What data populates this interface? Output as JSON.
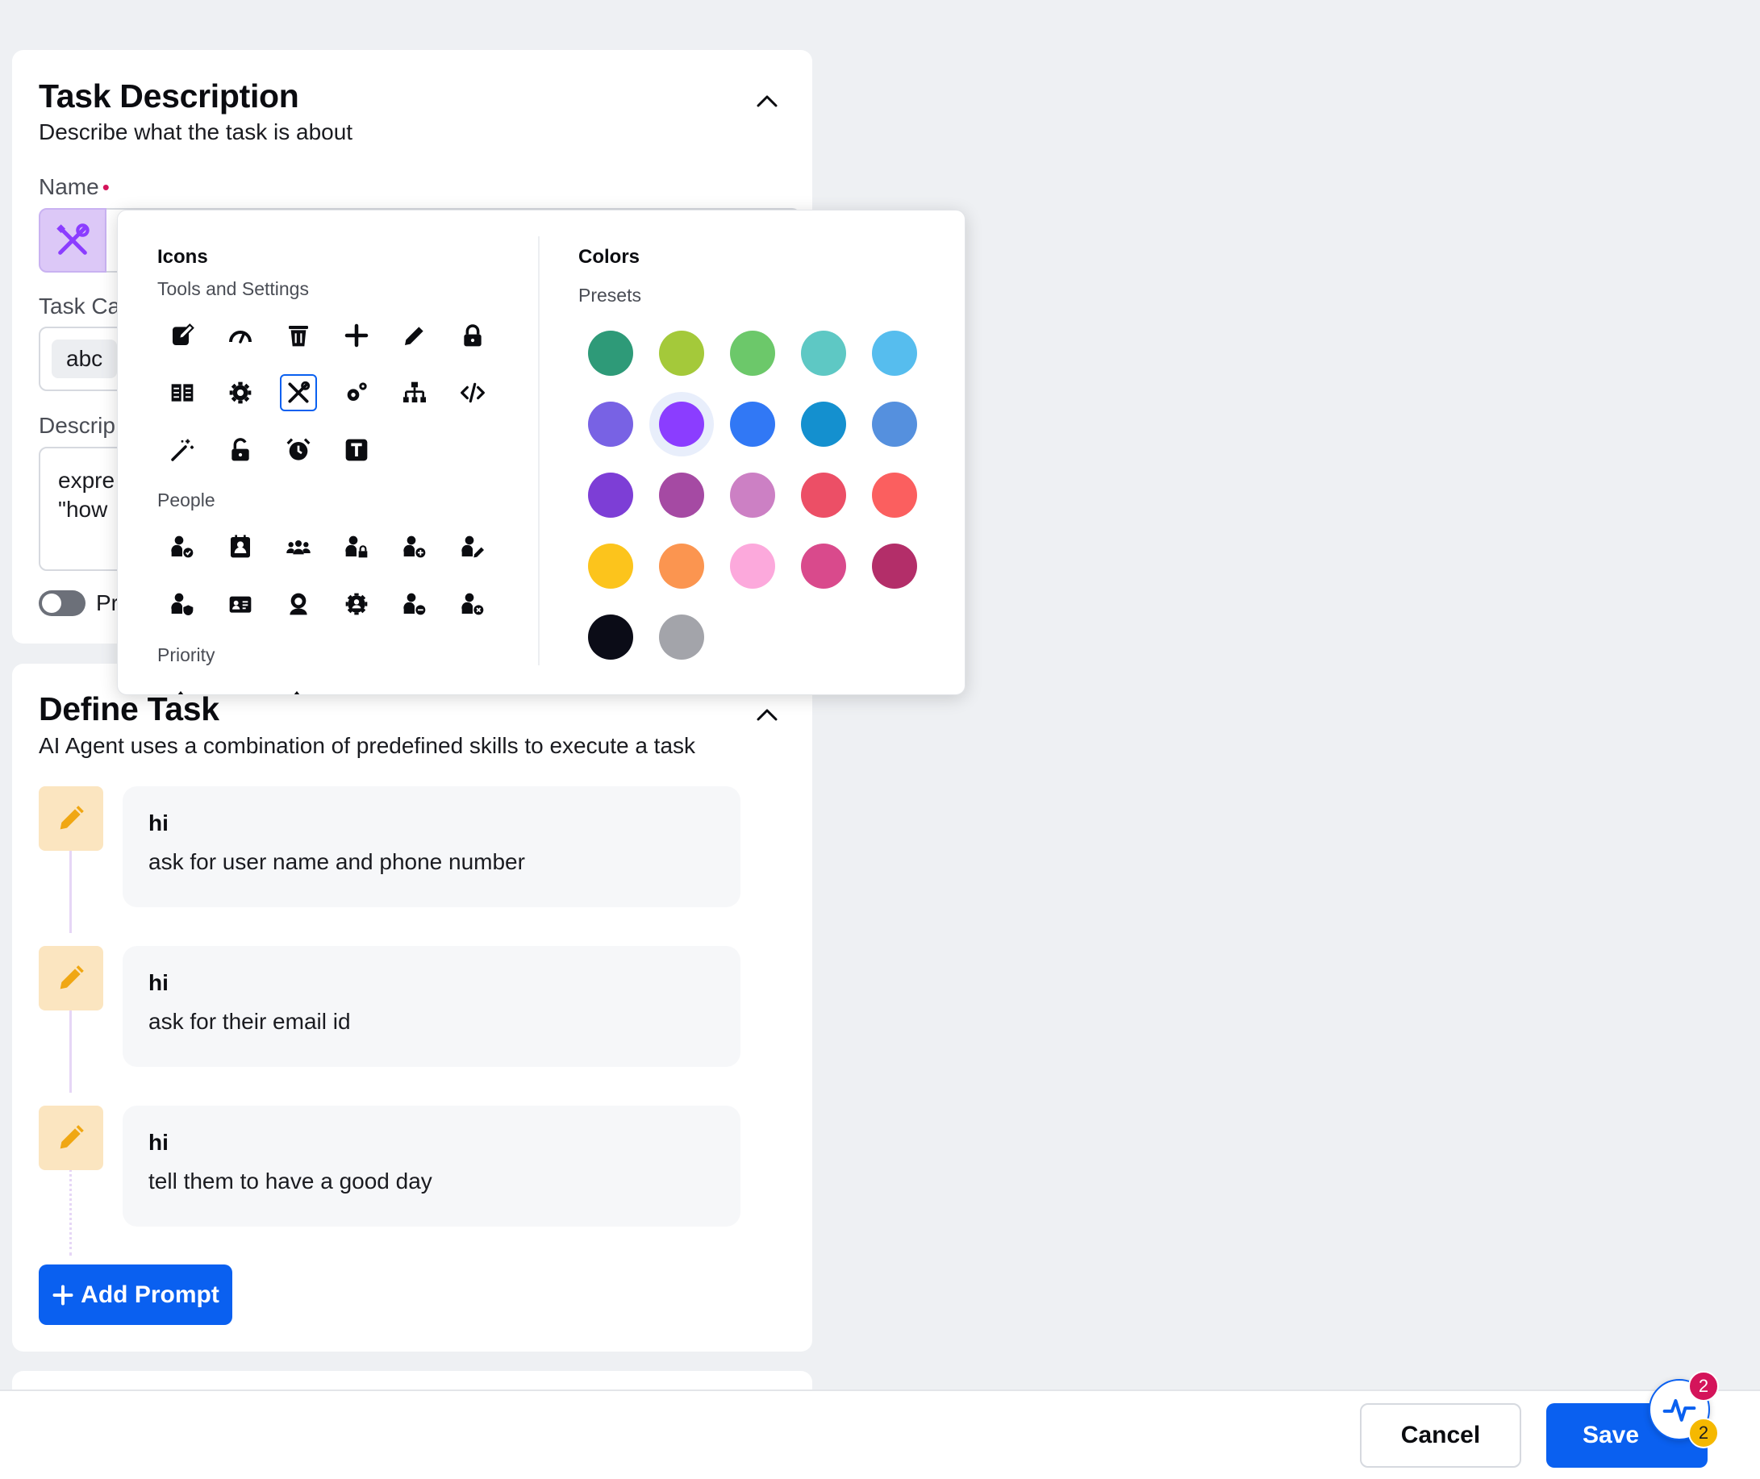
{
  "task_description": {
    "title": "Task Description",
    "subtitle": "Describe what the task is about",
    "name_label": "Name",
    "required_mark": "•",
    "category_label": "Task Ca",
    "category_chip": "abc",
    "description_label": "Descrip",
    "description_value": "expre\n\"how",
    "toggle_label": "Pr"
  },
  "define_task": {
    "title": "Define Task",
    "subtitle": "AI Agent uses a combination of predefined skills to execute a task",
    "steps": [
      {
        "title": "hi",
        "text": "ask for user name and phone number"
      },
      {
        "title": "hi",
        "text": "ask for their email id"
      },
      {
        "title": "hi",
        "text": "tell them to have a good day"
      }
    ],
    "add_button": "Add Prompt"
  },
  "picker": {
    "icons_heading": "Icons",
    "groups": [
      "Tools and Settings",
      "People",
      "Priority"
    ],
    "colors_heading": "Colors",
    "presets_label": "Presets",
    "selected_icon": "tools-icon",
    "selected_color": "#8b3dff",
    "colors": [
      "#2e9a78",
      "#a4c93a",
      "#6cc86a",
      "#5ec8c4",
      "#56bdee",
      "#7862e4",
      "#8b3dff",
      "#3178f5",
      "#1490cf",
      "#5590de",
      "#7d3ed6",
      "#a54aa3",
      "#cc80c4",
      "#ec4f66",
      "#fb5f5f",
      "#fcc41c",
      "#fb9550",
      "#fca9dc",
      "#d94a8c",
      "#b32e69",
      "#0b0c17",
      "#a3a4aa"
    ]
  },
  "footer": {
    "cancel": "Cancel",
    "save": "Save",
    "badge_red": "2",
    "badge_yellow": "2"
  }
}
